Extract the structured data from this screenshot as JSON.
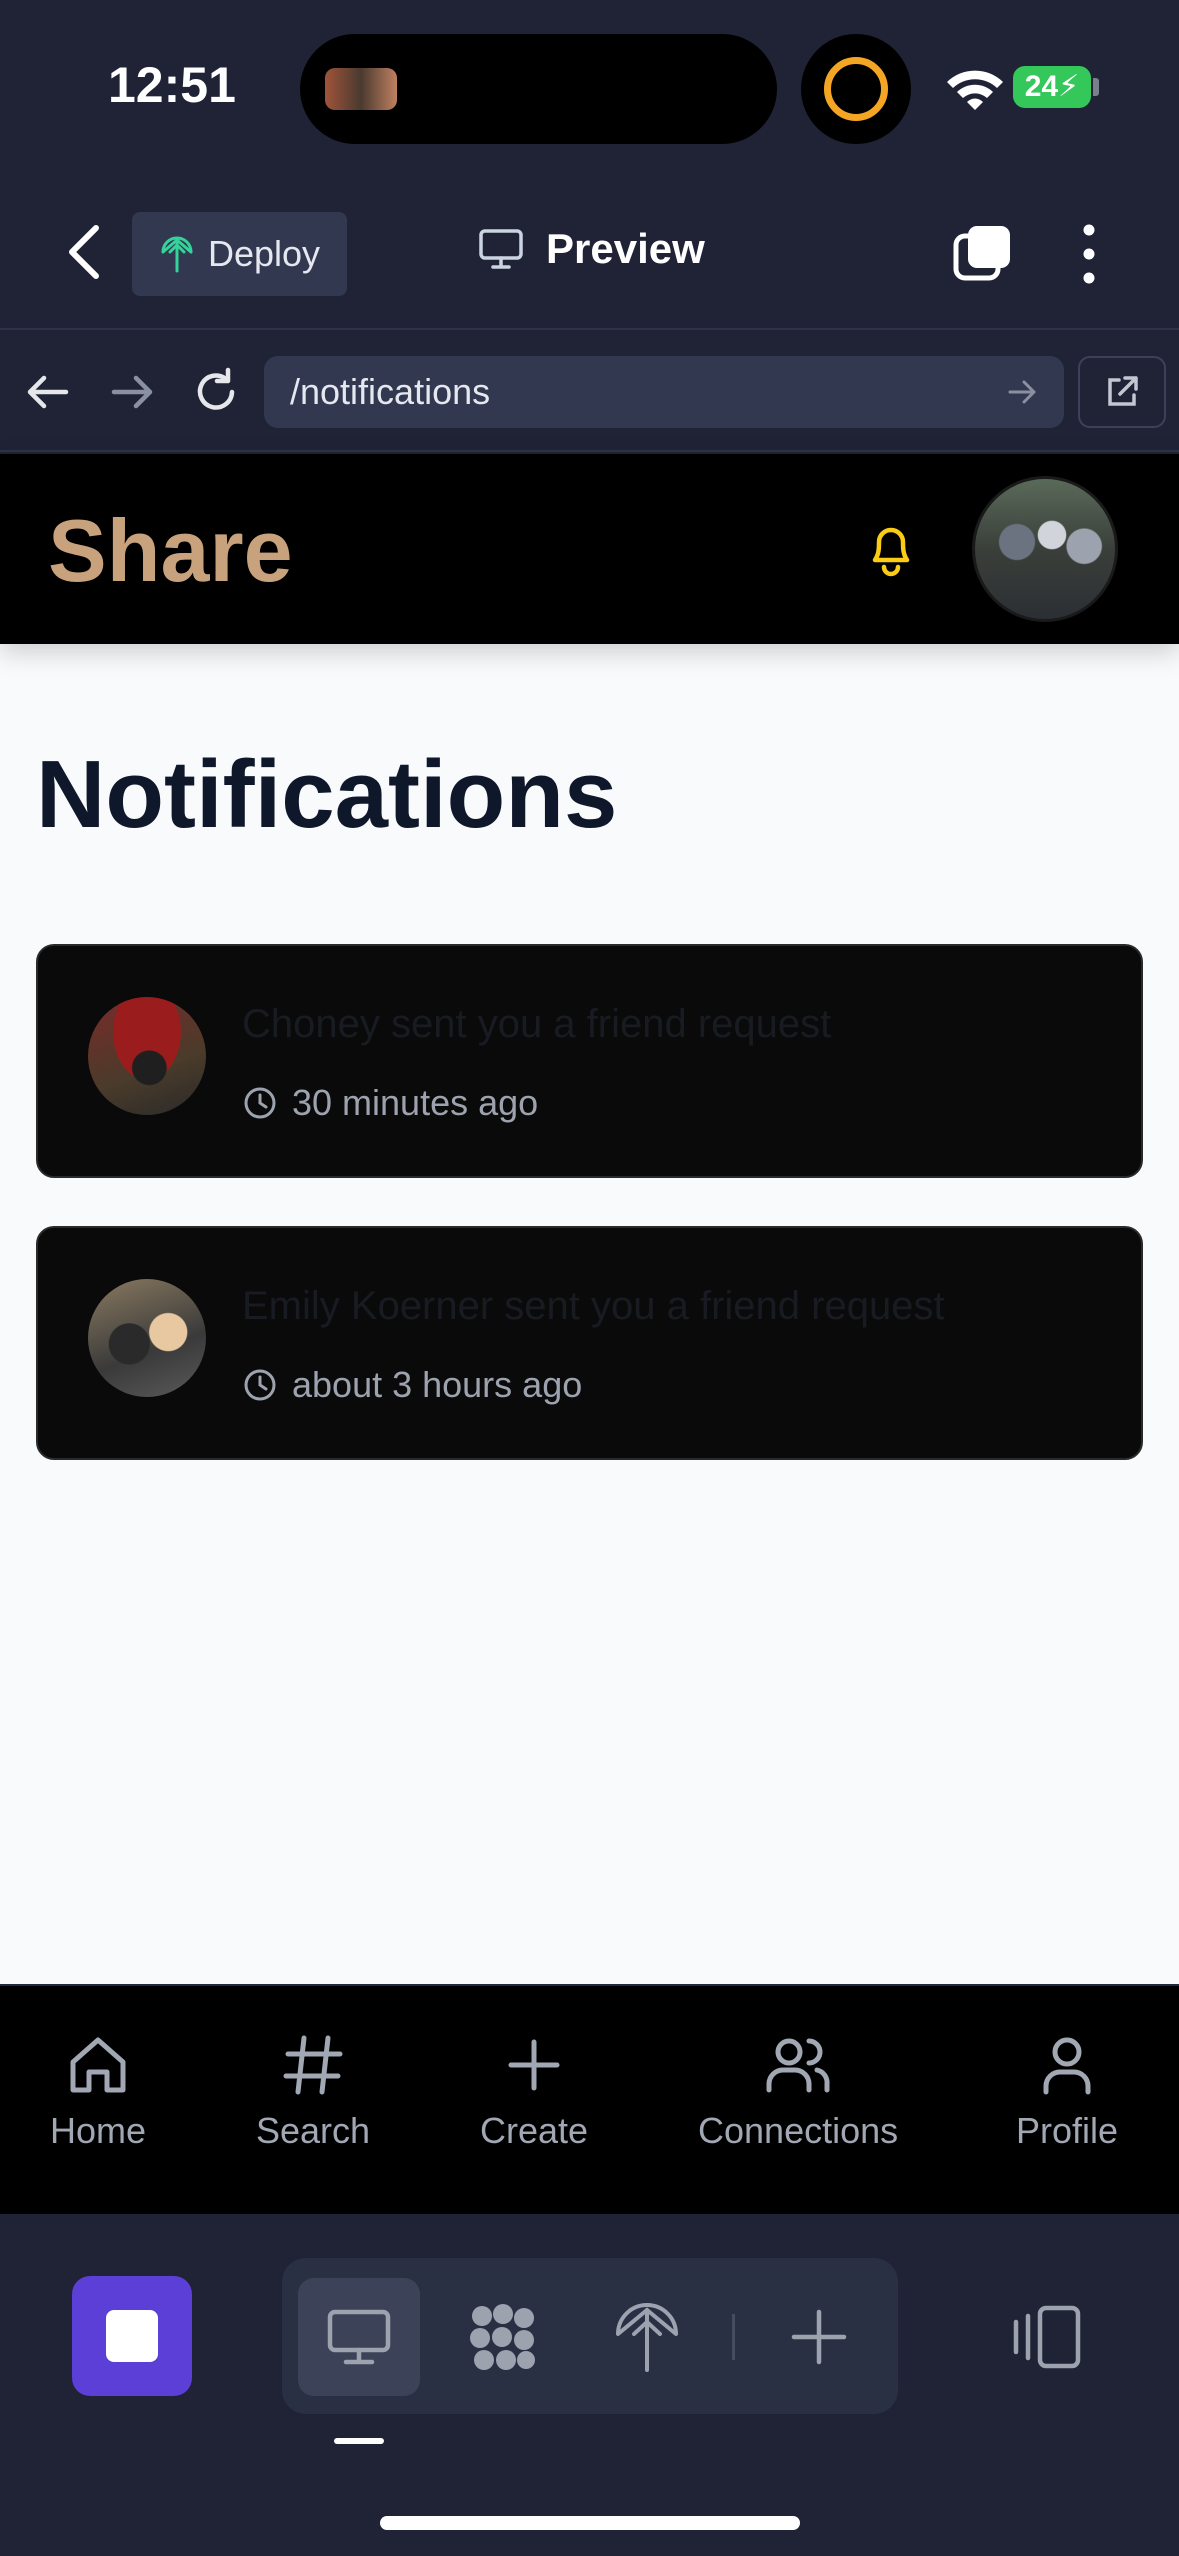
{
  "status_bar": {
    "time": "12:51",
    "battery": "24"
  },
  "toolbar": {
    "deploy_label": "Deploy",
    "preview_label": "Preview"
  },
  "url_bar": {
    "path": "/notifications"
  },
  "site": {
    "logo": "Share",
    "page_title": "Notifications"
  },
  "notifications": [
    {
      "message": "Choney sent you a friend request",
      "time": "30 minutes ago"
    },
    {
      "message": "Emily Koerner sent you a friend request",
      "time": "about 3 hours ago"
    }
  ],
  "site_nav": [
    {
      "label": "Home",
      "icon": "home-icon"
    },
    {
      "label": "Search",
      "icon": "hash-icon"
    },
    {
      "label": "Create",
      "icon": "plus-icon"
    },
    {
      "label": "Connections",
      "icon": "users-icon"
    },
    {
      "label": "Profile",
      "icon": "user-icon"
    }
  ],
  "colors": {
    "logo": "#c8a27c",
    "bell": "#facc15",
    "stop_button": "#5b3fd6",
    "app_chrome": "#1f2335"
  }
}
